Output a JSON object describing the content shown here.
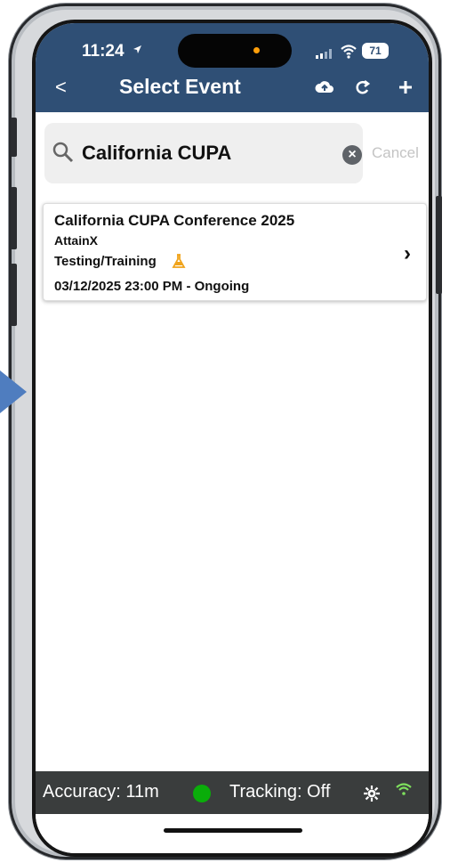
{
  "status_bar": {
    "time": "11:24",
    "battery": "71"
  },
  "header": {
    "back_label": "<",
    "title": "Select Event",
    "icons": [
      "cloud-upload-icon",
      "refresh-icon",
      "plus-icon"
    ]
  },
  "search": {
    "value": "California CUPA",
    "cancel_label": "Cancel",
    "clear_label": "×"
  },
  "events": [
    {
      "title": "California CUPA Conference 2025",
      "organization": "AttainX",
      "type": "Testing/Training",
      "datetime": "03/12/2025 23:00 PM - Ongoing"
    }
  ],
  "footer": {
    "accuracy": "Accuracy: 11m",
    "tracking": "Tracking: Off",
    "status_color": "#0aad0a"
  },
  "theme": {
    "header_color": "#2f4f75",
    "warning_color": "#f0a31a"
  }
}
